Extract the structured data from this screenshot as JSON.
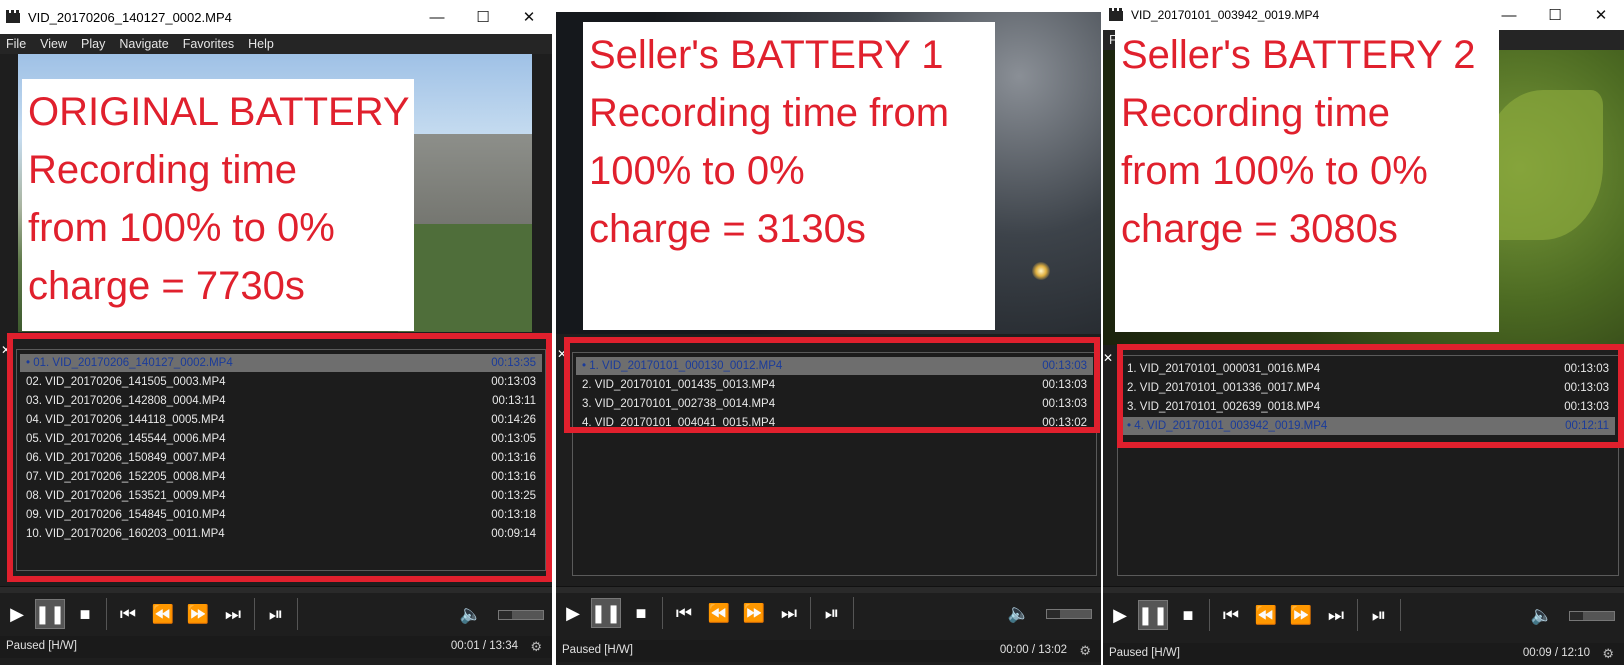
{
  "panels": [
    {
      "title": "VID_20170206_140127_0002.MP4",
      "menu": [
        "File",
        "View",
        "Play",
        "Navigate",
        "Favorites",
        "Help"
      ],
      "overlay": [
        "ORIGINAL BATTERY",
        "Recording time",
        "from 100% to 0%",
        "charge = 7730s"
      ],
      "playlist": [
        {
          "name": "01. VID_20170206_140127_0002.MP4",
          "time": "00:13:35",
          "active": true
        },
        {
          "name": "02. VID_20170206_141505_0003.MP4",
          "time": "00:13:03"
        },
        {
          "name": "03. VID_20170206_142808_0004.MP4",
          "time": "00:13:11"
        },
        {
          "name": "04. VID_20170206_144118_0005.MP4",
          "time": "00:14:26"
        },
        {
          "name": "05. VID_20170206_145544_0006.MP4",
          "time": "00:13:05"
        },
        {
          "name": "06. VID_20170206_150849_0007.MP4",
          "time": "00:13:16"
        },
        {
          "name": "07. VID_20170206_152205_0008.MP4",
          "time": "00:13:16"
        },
        {
          "name": "08. VID_20170206_153521_0009.MP4",
          "time": "00:13:25"
        },
        {
          "name": "09. VID_20170206_154845_0010.MP4",
          "time": "00:13:18"
        },
        {
          "name": "10. VID_20170206_160203_0011.MP4",
          "time": "00:09:14"
        }
      ],
      "status": "Paused [H/W]",
      "time": "00:01 / 13:34"
    },
    {
      "title": "",
      "menu": [],
      "overlay": [
        "Seller's BATTERY 1",
        "Recording time from",
        "100% to 0%",
        "charge = 3130s"
      ],
      "playlist": [
        {
          "name": "1. VID_20170101_000130_0012.MP4",
          "time": "00:13:03",
          "active": true
        },
        {
          "name": "2. VID_20170101_001435_0013.MP4",
          "time": "00:13:03"
        },
        {
          "name": "3. VID_20170101_002738_0014.MP4",
          "time": "00:13:03"
        },
        {
          "name": "4. VID_20170101_004041_0015.MP4",
          "time": "00:13:02"
        }
      ],
      "status": "Paused [H/W]",
      "time": "00:00 / 13:02"
    },
    {
      "title": "VID_20170101_003942_0019.MP4",
      "menu": [
        "File"
      ],
      "overlay": [
        "Seller's BATTERY 2",
        "Recording time",
        "from 100% to 0%",
        "charge = 3080s"
      ],
      "playlist": [
        {
          "name": "1. VID_20170101_000031_0016.MP4",
          "time": "00:13:03"
        },
        {
          "name": "2. VID_20170101_001336_0017.MP4",
          "time": "00:13:03"
        },
        {
          "name": "3. VID_20170101_002639_0018.MP4",
          "time": "00:13:03"
        },
        {
          "name": "4. VID_20170101_003942_0019.MP4",
          "time": "00:12:11",
          "active": true
        }
      ],
      "status": "Paused [H/W]",
      "time": "00:09 / 12:10"
    }
  ],
  "icons": {
    "play": "play-icon",
    "pause": "pause-icon",
    "stop": "stop-icon",
    "prev": "skip-previous-icon",
    "rewind": "rewind-icon",
    "forward": "fast-forward-icon",
    "next": "skip-next-icon",
    "frame": "frame-step-icon",
    "volume": "volume-icon"
  },
  "colors": {
    "highlight": "#e0202d",
    "active_text": "#1a3b9a"
  }
}
